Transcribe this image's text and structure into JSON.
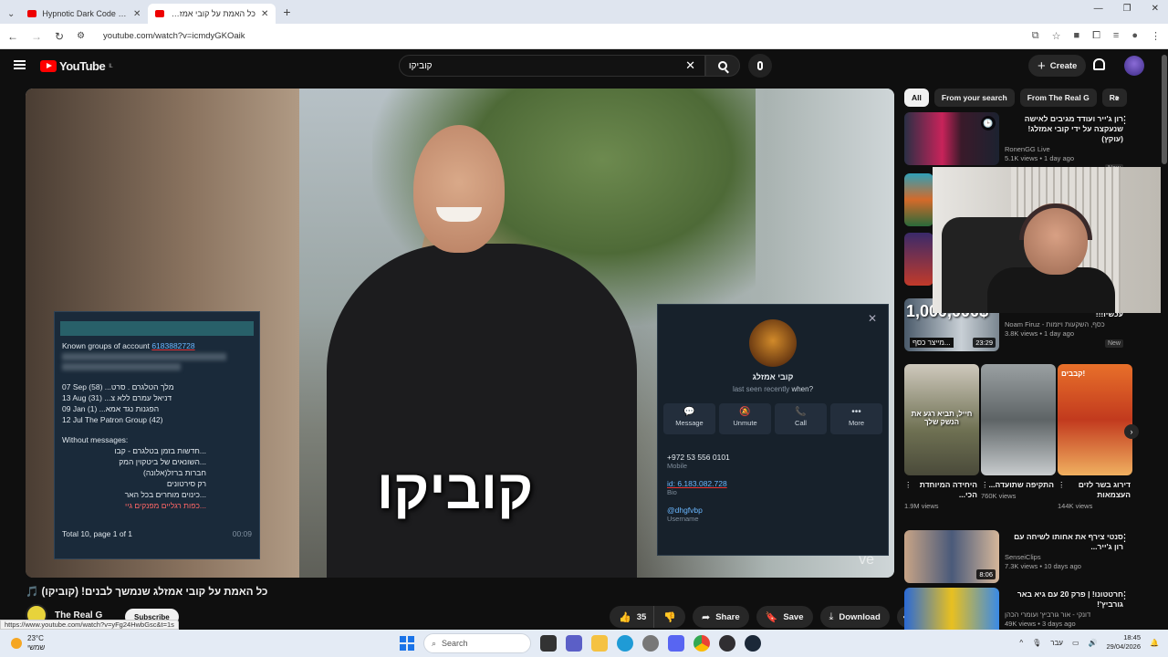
{
  "browser": {
    "tabs": [
      {
        "title": "Hypnotic Dark Code | Futuristic",
        "active": false
      },
      {
        "title": "כל האמת על קובי אמזלג שנ",
        "active": true
      }
    ],
    "url": "youtube.com/watch?v=icmdyGKOaik",
    "hover_url": "https://www.youtube.com/watch?v=yFg24HwbGsc&t=1s"
  },
  "youtube": {
    "logo_text": "YouTube",
    "logo_region": "IL",
    "search_value": "קוביקו",
    "create_label": "Create"
  },
  "video": {
    "overlay_text": "קוביקו",
    "watermark": "ve",
    "title": "כל האמת על קובי אמזלג שנמשך לבנים! (קוביקו) 🎵",
    "channel": "The Real G",
    "subscribe_label": "Subscribe",
    "likes": "35",
    "share_label": "Share",
    "save_label": "Save",
    "download_label": "Download"
  },
  "groups_panel": {
    "header_prefix": "Known groups of account",
    "account_id": "6183882728",
    "rows": [
      "07 Sep (58) ...מלך הטלגרם . סרט",
      "13 Aug (31) ...דניאל עמרם ללא צ",
      "09 Jan (1) ...הפגנות נגד אמא",
      "12 Jul The Patron Group (42)"
    ],
    "without_label": "Without messages:",
    "without_rows": [
      "...חדשות בזמן בטלגרם - קבו",
      "...השונאים של ביטקוין המק",
      "חברות ברזל(אלונה)",
      "רק סירטונים",
      "...כינוים מוחרים בכל האר",
      "...כפות רגליים מפנקים גיי"
    ],
    "footer": "Total 10, page 1 of 1",
    "time": "00:09"
  },
  "contact_panel": {
    "name": "קובי אמזלג",
    "seen": "last seen recently",
    "when": "when?",
    "actions": [
      "Message",
      "Unmute",
      "Call",
      "More"
    ],
    "phone": "+972 53 556 0101",
    "phone_label": "Mobile",
    "id_value": "id: 6.183.082.728",
    "id_label": "Bio",
    "username": "@dhgfvbp",
    "username_label": "Username"
  },
  "sidebar": {
    "chips": [
      "All",
      "From your search",
      "From The Real G",
      "Re"
    ],
    "recs": [
      {
        "title": "רון ג'ייר ועודד מגיבים לאישה שנעקצה על ידי קובי אמזלג! (עוקץ)",
        "channel": "RonenGG Live",
        "stats": "5.1K views • 1 day ago",
        "badge": "New",
        "duration": ""
      },
      {
        "title": "עכשיו!!!",
        "channel": "Noam Firuz - כסף, השקעות ויזמות",
        "stats": "3.8K views • 1 day ago",
        "badge": "New",
        "duration": "23:29",
        "thumb_text": "1,000,000$",
        "thumb_caption": "מייצר כסף..."
      },
      {
        "title": "סנטי צירף את אחותו לשיחה עם רון ג'ייר...",
        "channel": "SenseiClips",
        "stats": "7.3K views • 10 days ago",
        "badge": "",
        "duration": "8:06"
      },
      {
        "title": "חרטטונו! | פרק 20 עם גיא באר גורביץ'!",
        "channel": "דונקי - אור גורביץ' ועומרי הכהן",
        "stats": "49K views • 3 days ago",
        "badge": "",
        "duration": ""
      }
    ],
    "shorts": [
      {
        "title": "היחידה המיוחדת הכי...",
        "views": "1.9M views",
        "caption": "חייל, תביא רגע את הנשק שלך"
      },
      {
        "title": "התקיפה שתועדה...",
        "views": "760K views",
        "caption": ""
      },
      {
        "title": "דירוג בשר לזים העצמאות",
        "views": "144K views",
        "caption": "קבבים!"
      }
    ]
  },
  "taskbar": {
    "temperature": "23°C",
    "weather_desc": "שמשי",
    "search_label": "Search",
    "lang": "עבר",
    "time": "18:45",
    "date": "29/04/2026"
  },
  "colors": {
    "yt_bg": "#0f0f0f",
    "yt_red": "#ff0000",
    "telegram_bg": "#17212b",
    "telegram_link": "#6ab7ff"
  }
}
